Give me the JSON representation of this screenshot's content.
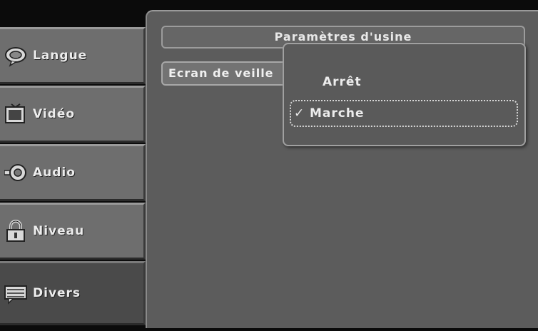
{
  "sidebar": {
    "items": [
      {
        "label": "Langue",
        "icon": "speech-bubble-icon"
      },
      {
        "label": "Vidéo",
        "icon": "tv-icon"
      },
      {
        "label": "Audio",
        "icon": "speaker-icon"
      },
      {
        "label": "Niveau",
        "icon": "padlock-icon"
      },
      {
        "label": "Divers",
        "icon": "display-icon"
      }
    ],
    "active": "Divers"
  },
  "main": {
    "factory_settings_label": "Paramètres d'usine",
    "screensaver_label": "Ecran de veille"
  },
  "popup": {
    "options": [
      {
        "label": "Arrêt",
        "selected": false
      },
      {
        "label": "Marche",
        "selected": true
      }
    ],
    "check_mark": "✓"
  }
}
